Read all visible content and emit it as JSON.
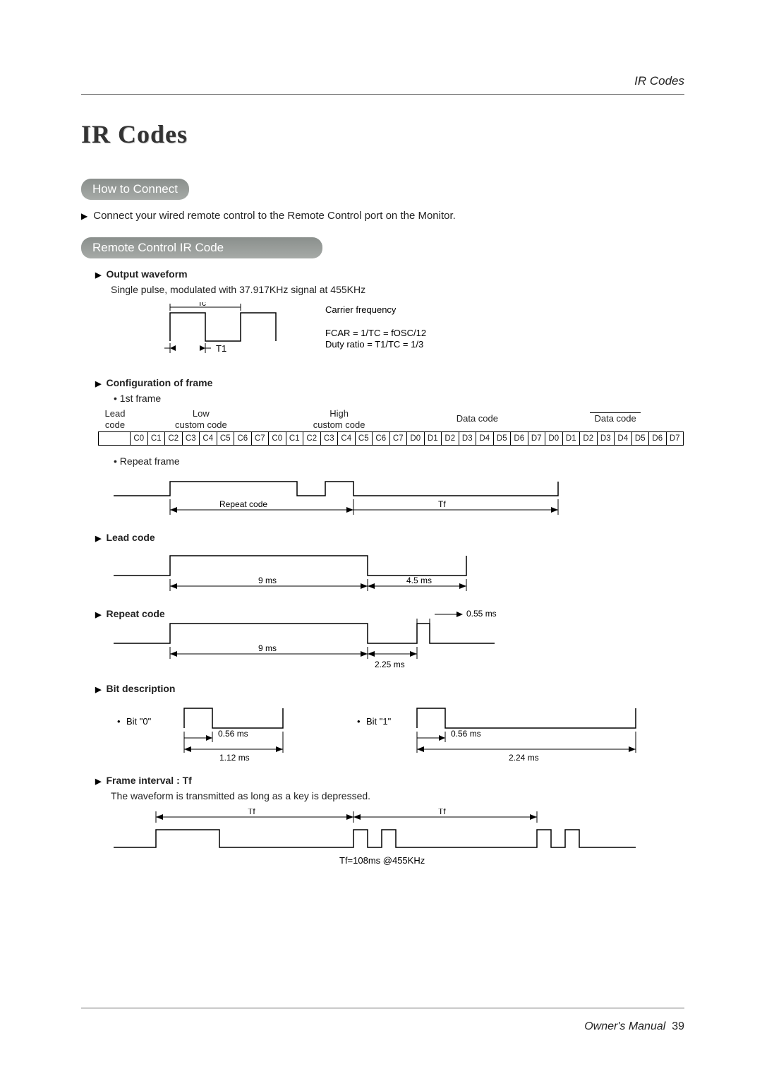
{
  "header": {
    "right": "IR Codes"
  },
  "title": "IR Codes",
  "howto": {
    "heading": "How to Connect",
    "text": "Connect your wired remote control to the Remote Control port on the Monitor."
  },
  "ircode_heading": "Remote Control IR Code",
  "output": {
    "heading": "Output waveform",
    "text": "Single pulse, modulated with 37.917KHz signal at 455KHz",
    "tc": "Tc",
    "t1": "T1",
    "cf_label": "Carrier frequency",
    "fcar": "FCAR = 1/TC = fOSC/12",
    "duty": "Duty ratio = T1/TC = 1/3"
  },
  "config": {
    "heading": "Configuration of frame",
    "first_frame": "1st frame",
    "lead_code": "Lead\ncode",
    "low_custom": "Low\ncustom code",
    "high_custom": "High\ncustom code",
    "data_code": "Data code",
    "data_code_bar": "Data code",
    "bits_c": [
      "C0",
      "C1",
      "C2",
      "C3",
      "C4",
      "C5",
      "C6",
      "C7"
    ],
    "bits_d": [
      "D0",
      "D1",
      "D2",
      "D3",
      "D4",
      "D5",
      "D6",
      "D7"
    ],
    "repeat_frame": "Repeat frame",
    "repeat_code": "Repeat code",
    "tf": "Tf"
  },
  "lead": {
    "heading": "Lead code",
    "t9": "9 ms",
    "t45": "4.5 ms"
  },
  "repeat": {
    "heading": "Repeat code",
    "t9": "9 ms",
    "t225": "2.25 ms",
    "t055": "0.55 ms"
  },
  "bit": {
    "heading": "Bit description",
    "bit0": "Bit \"0\"",
    "bit1": "Bit \"1\"",
    "t056a": "0.56 ms",
    "t056b": "0.56 ms",
    "t112": "1.12 ms",
    "t224": "2.24 ms"
  },
  "frame_int": {
    "heading": "Frame interval : Tf",
    "text": "The waveform is transmitted as long as a key is depressed.",
    "tf1": "Tf",
    "tf2": "Tf",
    "note": "Tf=108ms @455KHz"
  },
  "footer": {
    "manual": "Owner's Manual",
    "page": "39"
  }
}
